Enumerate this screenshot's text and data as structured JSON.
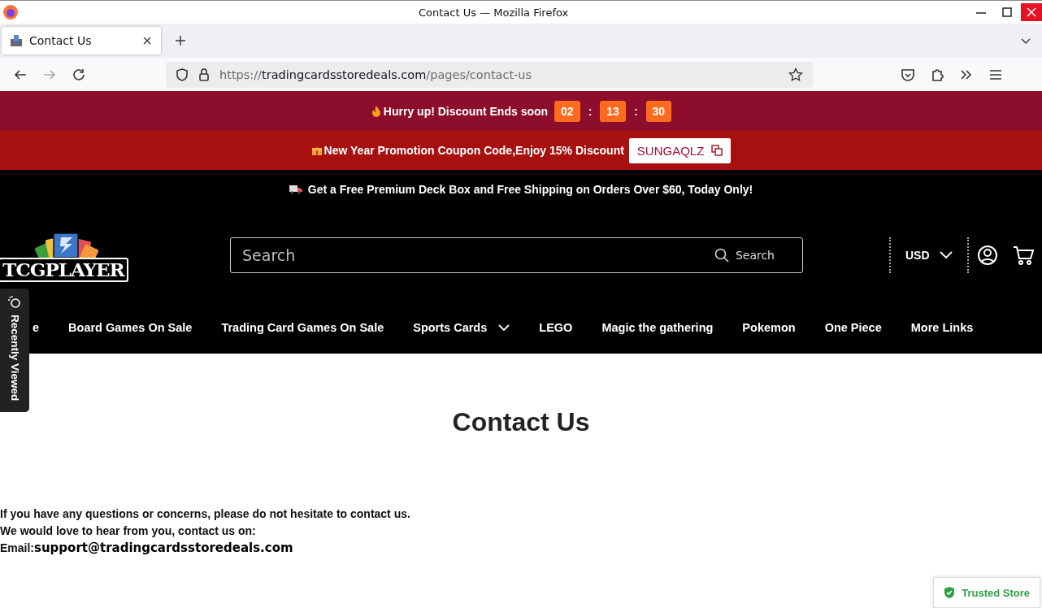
{
  "window": {
    "title": "Contact Us — Mozilla Firefox"
  },
  "tabs": [
    {
      "label": "Contact Us",
      "selected": true
    }
  ],
  "address_bar": {
    "scheme": "https://",
    "domain": "tradingcardsstoredeals.com",
    "path": "/pages/contact-us"
  },
  "countdown_bar": {
    "text": "Hurry up! Discount Ends soon",
    "timer": [
      {
        "kind": "digit",
        "text": "02"
      },
      {
        "kind": "separator",
        "text": ":"
      },
      {
        "kind": "digit",
        "text": "13"
      },
      {
        "kind": "separator",
        "text": ":"
      },
      {
        "kind": "digit",
        "text": "30"
      }
    ]
  },
  "coupon_bar": {
    "text": "New Year Promotion Coupon Code,Enjoy 15% Discount",
    "code": "SUNGAQLZ"
  },
  "shipping_bar": {
    "text": "Get a Free Premium Deck Box and Free Shipping on Orders Over $60, Today Only!"
  },
  "header": {
    "logo": "TCGPLAYER",
    "search_placeholder": "Search",
    "search_button": "Search",
    "currency": "USD"
  },
  "nav": [
    {
      "label": "e",
      "dropdown": false
    },
    {
      "label": "Board Games On Sale",
      "dropdown": false
    },
    {
      "label": "Trading Card Games On Sale",
      "dropdown": false
    },
    {
      "label": "Sports Cards",
      "dropdown": true
    },
    {
      "label": "LEGO",
      "dropdown": false
    },
    {
      "label": "Magic the gathering",
      "dropdown": false
    },
    {
      "label": "Pokemon",
      "dropdown": false
    },
    {
      "label": "One Piece",
      "dropdown": false
    },
    {
      "label": "More Links",
      "dropdown": false
    }
  ],
  "recently_viewed": "Recently Viewed",
  "page": {
    "title": "Contact Us",
    "lines": [
      "If you have any questions or concerns, please do not hesitate to contact us.",
      "We would love to hear from you, contact us on:"
    ],
    "email_label": "Email:",
    "email": "support@tradingcardsstoredeals.com"
  },
  "trusted_badge": "Trusted Store"
}
